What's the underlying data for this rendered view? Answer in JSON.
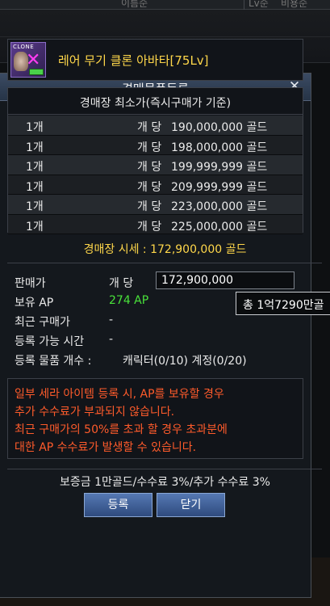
{
  "background": {
    "header_col1": "이름순",
    "header_col2": "Lv순",
    "header_col3": "비용순"
  },
  "dialog": {
    "title": "경매물품등록",
    "close_glyph": "✕"
  },
  "item": {
    "icon_badge": "CLONE",
    "name": "레어 무기 클론 아바타[75Lv]"
  },
  "lowest_prices": {
    "header": "경매장 최소가(즉시구매가 기준)",
    "rows": [
      {
        "qty": "1개",
        "per": "개 당",
        "price": "190,000,000 골드"
      },
      {
        "qty": "1개",
        "per": "개 당",
        "price": "198,000,000 골드"
      },
      {
        "qty": "1개",
        "per": "개 당",
        "price": "199,999,999 골드"
      },
      {
        "qty": "1개",
        "per": "개 당",
        "price": "209,999,999 골드"
      },
      {
        "qty": "1개",
        "per": "개 당",
        "price": "223,000,000 골드"
      },
      {
        "qty": "1개",
        "per": "개 당",
        "price": "225,000,000 골드"
      }
    ]
  },
  "market_price": "경매장 시세 : 172,900,000 골드",
  "form": {
    "sale_price_label": "판매가",
    "per_unit_label": "개 당",
    "sale_price_value": "172,900,000",
    "tooltip": "총 1억7290만골",
    "ap_label": "보유 AP",
    "ap_value": "274 AP",
    "recent_price_label": "최근 구매가",
    "recent_price_value": "-",
    "time_label": "등록 가능 시간",
    "time_value": "-",
    "count_label": "등록 물품 개수 :",
    "count_value": "캐릭터(0/10) 계정(0/20)"
  },
  "warning": {
    "lines": [
      "일부 세라 아이템 등록 시, AP를 보유할 경우",
      "추가 수수료가 부과되지 않습니다.",
      "최근 구매가의 50%를 초과 할 경우 초과분에",
      "대한 AP 수수료가 발생할 수 있습니다."
    ]
  },
  "fee_text": "보증금 1만골드/수수료 3%/추가 수수료 3%",
  "buttons": {
    "register": "등록",
    "close": "닫기"
  },
  "colors": {
    "accent_yellow": "#ffd74a",
    "warning_red": "#ff5b2b",
    "ap_green": "#49e23a",
    "title_blue": "#263447"
  }
}
